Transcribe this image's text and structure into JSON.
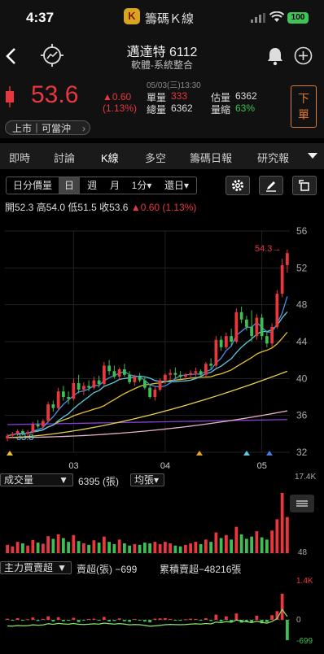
{
  "status": {
    "time": "4:37",
    "app_logo": "K",
    "app_title": "籌碼Ｋ線",
    "battery": "100"
  },
  "header": {
    "stock_title": "邁達特 6112",
    "industry": "軟體-系統整合"
  },
  "quote": {
    "price": "53.6",
    "change": "▲0.60",
    "change_pct": "(1.13%)",
    "datetime": "05/03(三)13:30",
    "single_label": "單量",
    "single_value": "333",
    "est_label": "估量",
    "est_value": "6362",
    "total_label": "總量",
    "total_value": "6362",
    "shrink_label": "量縮",
    "shrink_value": "63%",
    "market_button": "上市｜可當沖",
    "order_button": [
      "下",
      "單"
    ]
  },
  "tabs": [
    "即時",
    "討論",
    "K線",
    "多空",
    "籌碼日報",
    "研究報"
  ],
  "active_tab": "K線",
  "toolbar": {
    "period_items": [
      "日分價量",
      "日",
      "週",
      "月",
      "1分▾",
      "還日▾"
    ],
    "active_period": "日"
  },
  "ohlc": {
    "open": "開52.3",
    "high": "高54.0",
    "low": "低51.5",
    "close": "收53.6",
    "change": "▲0.60 (1.13%)"
  },
  "price_axis": [
    "56",
    "52",
    "48",
    "44",
    "40",
    "36",
    "32"
  ],
  "month_labels": [
    "03",
    "04",
    "05"
  ],
  "max_label": "54.3→",
  "min_label": "33.8",
  "volume": {
    "selector": "成交量",
    "value": "6395 (張)",
    "avg_button": "均張▾",
    "axis_top": "17.4K",
    "axis_bottom": "48"
  },
  "main_force": {
    "selector": "主力買賣超",
    "label": "賣超(張) −699",
    "cum_label": "累積賣超−48216張",
    "axis_top": "1.4K",
    "axis_zero": "0",
    "axis_bottom": "-699"
  },
  "colors": {
    "up": "#e8373d",
    "down": "#3dbf55",
    "accent": "#e07a2c",
    "ma5": "#4a90e2",
    "ma10": "#5ec8e0",
    "ma20": "#e8c12c",
    "ma60": "#e8d04c",
    "ma120": "#e8b4c8",
    "ma240": "#8a3fd6"
  },
  "chart_data": {
    "type": "candlestick",
    "ylim": [
      32,
      56
    ],
    "ohlc_last": {
      "open": 52.3,
      "high": 54.0,
      "low": 51.5,
      "close": 53.6
    },
    "candles": [
      [
        33.5,
        34.0,
        33.2,
        33.8
      ],
      [
        33.8,
        34.2,
        33.5,
        34.0
      ],
      [
        34.0,
        34.5,
        33.8,
        34.3
      ],
      [
        34.3,
        34.5,
        33.9,
        34.0
      ],
      [
        34.0,
        34.4,
        33.7,
        34.2
      ],
      [
        34.2,
        35.3,
        34.0,
        35.0
      ],
      [
        35.0,
        35.5,
        34.6,
        34.8
      ],
      [
        34.8,
        35.6,
        34.5,
        35.4
      ],
      [
        35.4,
        37.5,
        35.2,
        37.2
      ],
      [
        37.2,
        37.6,
        36.4,
        36.8
      ],
      [
        36.8,
        39.0,
        36.5,
        38.6
      ],
      [
        38.6,
        39.2,
        37.6,
        38.0
      ],
      [
        38.0,
        38.6,
        37.2,
        37.8
      ],
      [
        37.8,
        40.0,
        37.6,
        39.5
      ],
      [
        39.5,
        40.4,
        38.4,
        38.8
      ],
      [
        38.8,
        39.6,
        38.2,
        39.2
      ],
      [
        39.2,
        39.8,
        38.6,
        39.0
      ],
      [
        39.0,
        40.2,
        38.8,
        39.8
      ],
      [
        39.8,
        40.3,
        39.0,
        39.4
      ],
      [
        39.4,
        41.8,
        39.2,
        41.4
      ],
      [
        41.4,
        42.0,
        40.4,
        40.8
      ],
      [
        40.8,
        41.4,
        40.0,
        40.2
      ],
      [
        40.2,
        41.2,
        39.8,
        41.0
      ],
      [
        41.0,
        41.6,
        40.2,
        40.4
      ],
      [
        40.4,
        40.8,
        39.4,
        39.6
      ],
      [
        39.6,
        40.4,
        39.2,
        40.2
      ],
      [
        40.2,
        40.6,
        39.6,
        39.8
      ],
      [
        39.8,
        40.2,
        38.8,
        39.0
      ],
      [
        39.0,
        39.4,
        37.8,
        38.0
      ],
      [
        38.0,
        39.2,
        37.6,
        38.8
      ],
      [
        38.8,
        40.0,
        38.6,
        39.8
      ],
      [
        39.8,
        40.6,
        39.4,
        40.4
      ],
      [
        40.4,
        41.0,
        39.8,
        40.6
      ],
      [
        40.6,
        41.2,
        40.0,
        40.4
      ],
      [
        40.4,
        40.8,
        39.8,
        40.2
      ],
      [
        40.2,
        40.6,
        39.8,
        40.4
      ],
      [
        40.4,
        40.9,
        40.0,
        40.6
      ],
      [
        40.6,
        41.2,
        40.2,
        40.8
      ],
      [
        40.8,
        41.0,
        40.2,
        40.4
      ],
      [
        40.4,
        41.8,
        40.2,
        41.6
      ],
      [
        41.6,
        42.2,
        41.0,
        41.4
      ],
      [
        41.4,
        44.6,
        41.2,
        44.2
      ],
      [
        44.2,
        44.6,
        43.0,
        43.4
      ],
      [
        43.4,
        45.0,
        43.2,
        44.6
      ],
      [
        44.6,
        45.4,
        43.6,
        44.0
      ],
      [
        44.0,
        47.6,
        43.8,
        47.2
      ],
      [
        47.2,
        47.8,
        46.0,
        46.4
      ],
      [
        46.4,
        46.8,
        45.2,
        45.6
      ],
      [
        45.6,
        47.4,
        44.0,
        44.6
      ],
      [
        44.6,
        47.0,
        44.2,
        46.6
      ],
      [
        46.6,
        47.0,
        44.2,
        44.6
      ],
      [
        44.6,
        45.2,
        43.4,
        43.8
      ],
      [
        43.8,
        46.0,
        43.4,
        45.6
      ],
      [
        45.6,
        49.6,
        45.4,
        49.2
      ],
      [
        49.2,
        53.0,
        48.8,
        52.3
      ],
      [
        52.3,
        54.0,
        51.5,
        53.6
      ]
    ],
    "volume": [
      22,
      18,
      30,
      26,
      20,
      35,
      28,
      25,
      45,
      38,
      50,
      40,
      30,
      48,
      32,
      26,
      22,
      34,
      28,
      44,
      30,
      24,
      36,
      26,
      20,
      24,
      22,
      28,
      26,
      30,
      24,
      30,
      26,
      20,
      18,
      22,
      26,
      30,
      24,
      36,
      30,
      55,
      40,
      48,
      36,
      70,
      50,
      38,
      44,
      58,
      42,
      36,
      60,
      90,
      160,
      96
    ],
    "main_force": [
      40,
      -20,
      60,
      -30,
      20,
      80,
      -40,
      30,
      120,
      -60,
      90,
      -50,
      -30,
      70,
      -80,
      -20,
      30,
      40,
      -30,
      100,
      -60,
      -40,
      50,
      -50,
      -70,
      30,
      -20,
      -60,
      -90,
      40,
      50,
      60,
      30,
      -20,
      -10,
      20,
      40,
      30,
      -30,
      60,
      -40,
      180,
      -60,
      120,
      -80,
      220,
      -100,
      -60,
      -90,
      140,
      -120,
      -80,
      160,
      300,
      900,
      -699
    ]
  }
}
